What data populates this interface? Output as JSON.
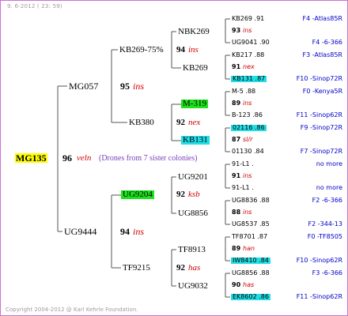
{
  "header": "9. 6-2012 ( 23: 59)",
  "footer": "Copyright 2004-2012 @ Karl Kehrle Foundation.",
  "root": {
    "name": "MG135",
    "number": "96",
    "gene": "veln",
    "note": "(Drones from 7 sister colonies)"
  },
  "parents": {
    "upper": {
      "name": "MG057",
      "number": "95",
      "gene": "ins"
    },
    "lower": {
      "name": "UG9444",
      "number": "94",
      "gene": "ins"
    }
  },
  "grandparents": [
    {
      "name": "KB269-75%",
      "number": "94",
      "gene": "ins"
    },
    {
      "name": "KB380",
      "number": "92",
      "gene": "nex"
    },
    {
      "name": "UG9204",
      "number": "92",
      "gene": "ksb"
    },
    {
      "name": "TF9215",
      "number": "92",
      "gene": "has"
    }
  ],
  "great_grandparents": [
    {
      "name": "NBK269",
      "number": "93",
      "gene": "ins"
    },
    {
      "name": "KB269",
      "number": "91",
      "gene": "nex"
    },
    {
      "name": "M-319",
      "number": "89",
      "gene": "ins"
    },
    {
      "name": "KB131",
      "number": "87",
      "gene": "sl/r"
    },
    {
      "name": "UG9201",
      "number": "91",
      "gene": "ins"
    },
    {
      "name": "UG8856",
      "number": "88",
      "gene": "ins"
    },
    {
      "name": "TF8913",
      "number": "89",
      "gene": "han"
    },
    {
      "name": "UG9032",
      "number": "90",
      "gene": "has"
    }
  ],
  "rows": [
    {
      "name": "KB269 .91",
      "right": "F4 -Atlas85R"
    },
    {
      "name": "UG9041 .90",
      "right": "F4 -6-366"
    },
    {
      "name": "KB217 .88",
      "right": "F3 -Atlas85R"
    },
    {
      "name": "KB131 .87",
      "right": "F10 -Sinop72R"
    },
    {
      "name": "M-5 .88",
      "right": "F0 -Kenya5R"
    },
    {
      "name": "B-123 .86",
      "right": "F11 -Sinop62R"
    },
    {
      "name": "02116 .86",
      "right": "F9 -Sinop72R"
    },
    {
      "name": "01130 .84",
      "right": "F7 -Sinop72R"
    },
    {
      "name": "91-L1 .",
      "right": "no more"
    },
    {
      "name": "91-L1 .",
      "right": "no more"
    },
    {
      "name": "UG8836 .88",
      "right": "F2 -6-366"
    },
    {
      "name": "UG8537 .85",
      "right": "F2 -344-13"
    },
    {
      "name": "TF8701 .87",
      "right": "F0 -TF8505"
    },
    {
      "name": "IW8410 .84",
      "right": "F10 -Sinop62R"
    },
    {
      "name": "UG8856 .88",
      "right": "F3 -6-366"
    },
    {
      "name": "EK8602 .86",
      "right": "F11 -Sinop62R"
    }
  ],
  "colors": {
    "frame": "#d070d0",
    "root_highlight": "#ffff00",
    "green_highlight": "#1de11d",
    "cyan_highlight": "#22dde6",
    "right_text": "#0000c8",
    "gene_text": "#d00000",
    "note_text": "#7a3cbd"
  }
}
